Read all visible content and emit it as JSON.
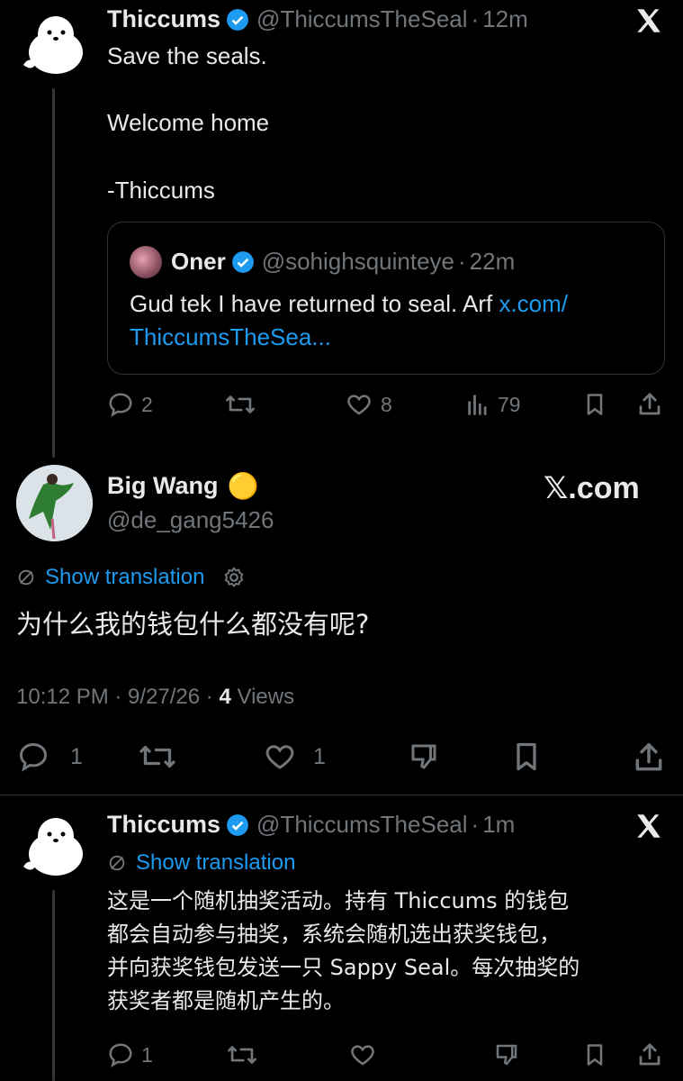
{
  "tweet1": {
    "author": "Thiccums",
    "handle": "@ThiccumsTheSeal",
    "sep": "·",
    "time": "12m",
    "line1": "Save the seals.",
    "line2": "Welcome home",
    "line3": "-Thiccums",
    "quote": {
      "author": "Oner",
      "handle": "@sohighsquinteye",
      "sep": "·",
      "time": "22m",
      "text": "Gud tek I have returned to seal. Arf ",
      "link1": "x.com/",
      "link2": "ThiccumsTheSea..."
    },
    "stats": {
      "replies": "2",
      "likes": "8",
      "views": "79"
    }
  },
  "main": {
    "author": "Big Wang",
    "emoji": "🟡",
    "handle": "@de_gang5426",
    "brand": "𝕏.com",
    "translate": "Show translation",
    "text": "为什么我的钱包什么都没有呢?",
    "time": "10:12 PM · 9/27/26 · ",
    "views_count": "4",
    "views_label": " Views",
    "stats": {
      "replies": "1",
      "likes": "1"
    }
  },
  "reply": {
    "author": "Thiccums",
    "handle": "@ThiccumsTheSeal",
    "sep": "·",
    "time": "1m",
    "translate": "Show translation",
    "line1": "这是一个随机抽奖活动。持有 Thiccums 的钱包",
    "line2": "都会自动参与抽奖，系统会随机选出获奖钱包，",
    "line3": "并向获奖钱包发送一只 Sappy Seal。每次抽奖的",
    "line4": "获奖者都是随机产生的。",
    "stats": {
      "replies": "1"
    }
  },
  "colors": {
    "accent": "#1d9bf0",
    "muted": "#71767b",
    "text": "#e7e9ea",
    "bg": "#000000"
  }
}
